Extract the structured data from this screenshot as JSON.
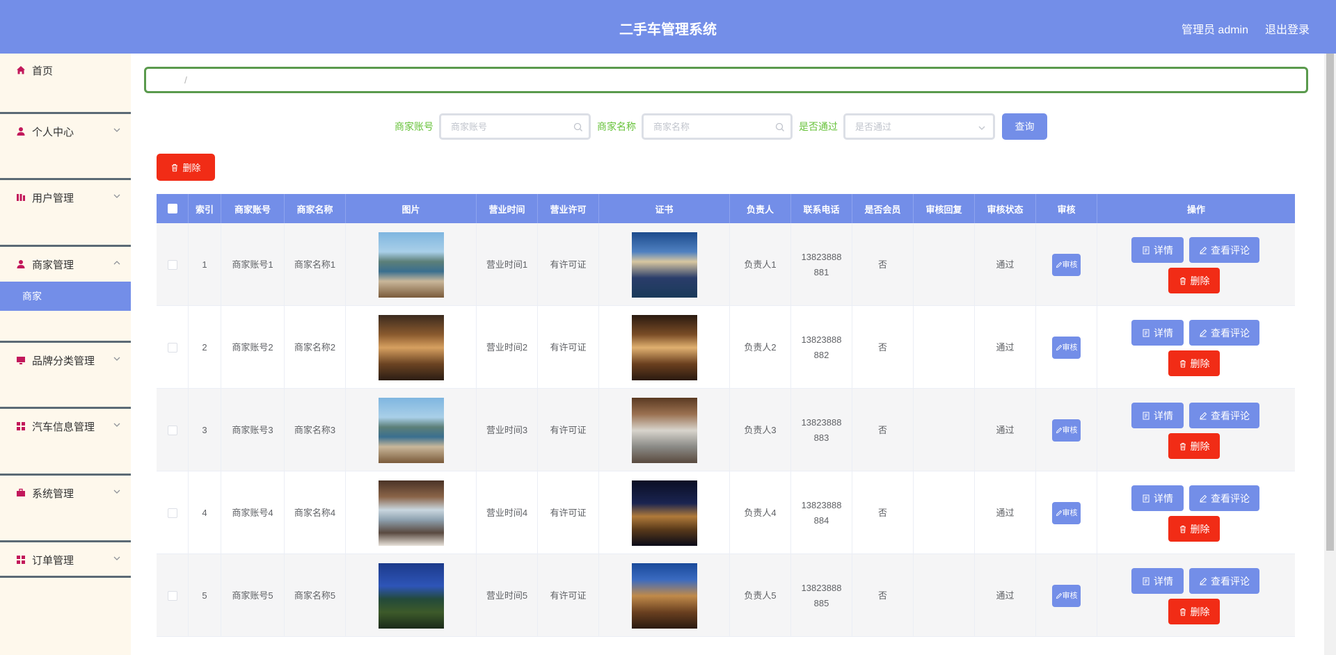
{
  "header": {
    "title": "二手车管理系统",
    "user": "管理员 admin",
    "logout": "退出登录"
  },
  "sidebar": {
    "items": [
      {
        "label": "首页",
        "icon": "home-icon"
      },
      {
        "label": "个人中心",
        "icon": "user-icon"
      },
      {
        "label": "用户管理",
        "icon": "bars-icon"
      },
      {
        "label": "商家管理",
        "icon": "user-icon",
        "sub": "商家"
      },
      {
        "label": "品牌分类管理",
        "icon": "monitor-icon"
      },
      {
        "label": "汽车信息管理",
        "icon": "grid-icon"
      },
      {
        "label": "系统管理",
        "icon": "briefcase-icon"
      },
      {
        "label": "订单管理",
        "icon": "grid-icon"
      }
    ]
  },
  "breadcrumb": {
    "sep": "/"
  },
  "search": {
    "account_label": "商家账号",
    "account_placeholder": "商家账号",
    "name_label": "商家名称",
    "name_placeholder": "商家名称",
    "pass_label": "是否通过",
    "pass_placeholder": "是否通过",
    "query": "查询"
  },
  "toolbar": {
    "delete": "删除"
  },
  "table": {
    "headers": [
      "索引",
      "商家账号",
      "商家名称",
      "图片",
      "营业时间",
      "营业许可",
      "证书",
      "负责人",
      "联系电话",
      "是否会员",
      "审核回复",
      "审核状态",
      "审核",
      "操作"
    ],
    "rows": [
      {
        "idx": "1",
        "account": "商家账号1",
        "name": "商家名称1",
        "hours": "营业时间1",
        "license": "有许可证",
        "owner": "负责人1",
        "phone_a": "13823888",
        "phone_b": "881",
        "member": "否",
        "reply": "",
        "status": "通过"
      },
      {
        "idx": "2",
        "account": "商家账号2",
        "name": "商家名称2",
        "hours": "营业时间2",
        "license": "有许可证",
        "owner": "负责人2",
        "phone_a": "13823888",
        "phone_b": "882",
        "member": "否",
        "reply": "",
        "status": "通过"
      },
      {
        "idx": "3",
        "account": "商家账号3",
        "name": "商家名称3",
        "hours": "营业时间3",
        "license": "有许可证",
        "owner": "负责人3",
        "phone_a": "13823888",
        "phone_b": "883",
        "member": "否",
        "reply": "",
        "status": "通过"
      },
      {
        "idx": "4",
        "account": "商家账号4",
        "name": "商家名称4",
        "hours": "营业时间4",
        "license": "有许可证",
        "owner": "负责人4",
        "phone_a": "13823888",
        "phone_b": "884",
        "member": "否",
        "reply": "",
        "status": "通过"
      },
      {
        "idx": "5",
        "account": "商家账号5",
        "name": "商家名称5",
        "hours": "营业时间5",
        "license": "有许可证",
        "owner": "负责人5",
        "phone_a": "13823888",
        "phone_b": "885",
        "member": "否",
        "reply": "",
        "status": "通过"
      }
    ],
    "audit_label": "审核",
    "detail_label": "详情",
    "review_label": "查看评论",
    "delete_label": "删除"
  },
  "colors": {
    "primary": "#738ee8",
    "danger": "#f12c16",
    "success": "#67c23a",
    "sidebar_bg": "#fef8ec"
  }
}
